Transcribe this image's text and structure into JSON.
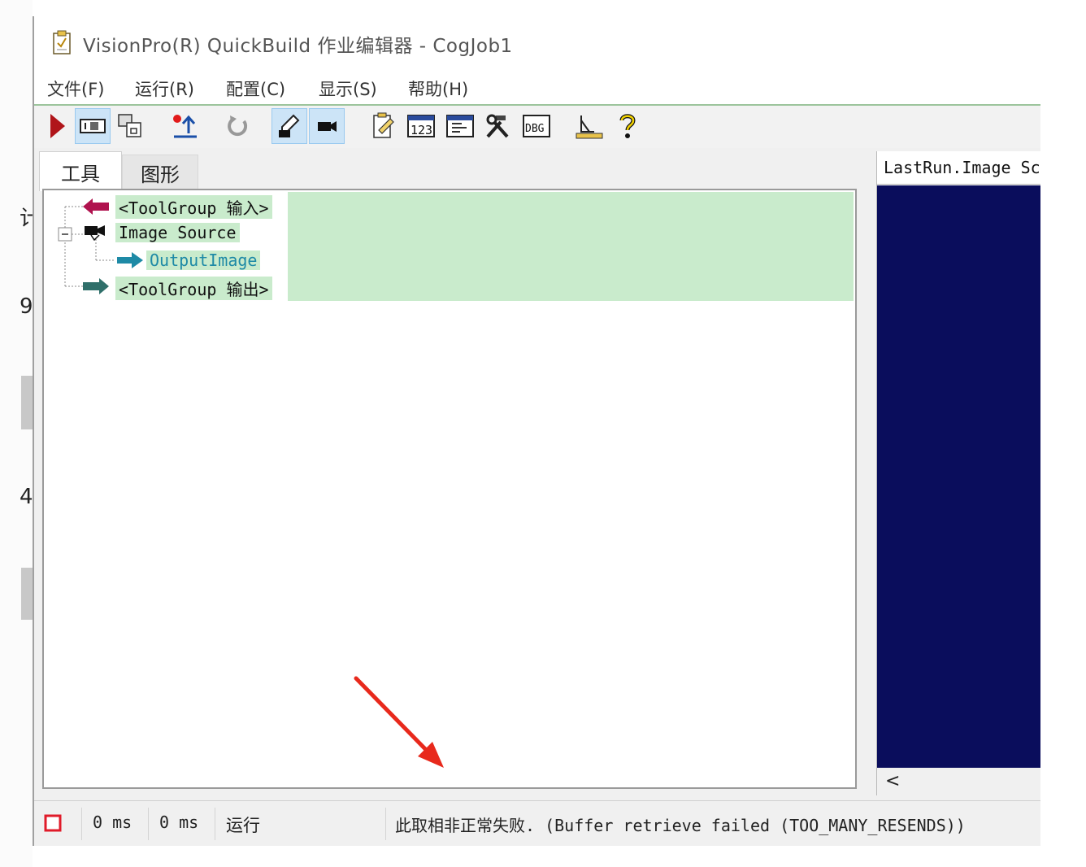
{
  "background_window": {
    "clipped_chars": [
      "计",
      "9.",
      "4."
    ]
  },
  "window": {
    "title": "VisionPro(R) QuickBuild 作业编辑器 - CogJob1"
  },
  "menu": {
    "items": [
      "文件(F)",
      "运行(R)",
      "配置(C)",
      "显示(S)",
      "帮助(H)"
    ]
  },
  "toolbar": {
    "buttons": [
      {
        "icon": "run-icon"
      },
      {
        "icon": "job-view-icon",
        "pressed": true
      },
      {
        "icon": "copy-window-icon"
      },
      {
        "icon": "upload-icon"
      },
      {
        "icon": "reset-icon"
      },
      {
        "icon": "edit-tool-icon",
        "pressed": true
      },
      {
        "icon": "camera-icon",
        "pressed": true
      },
      {
        "icon": "notepad-icon"
      },
      {
        "icon": "counter-123-icon"
      },
      {
        "icon": "display-icon"
      },
      {
        "icon": "hammer-wrench-icon"
      },
      {
        "icon": "dbg-icon"
      },
      {
        "icon": "geometry-ruler-icon"
      },
      {
        "icon": "help-icon"
      }
    ]
  },
  "tabs": {
    "tools": "工具",
    "graphics": "图形"
  },
  "tree": {
    "input": "<ToolGroup 输入>",
    "image_source": "Image Source",
    "output_image": "OutputImage",
    "output": "<ToolGroup 输出>"
  },
  "right_panel": {
    "title": "LastRun.Image Sc",
    "scroll_left": "<"
  },
  "status": {
    "time1": "0 ms",
    "time2": "0 ms",
    "state": "运行",
    "message": "此取相非正常失败. (Buffer retrieve failed (TOO_MANY_RESENDS))"
  },
  "colors": {
    "tree_highlight": "#c9ebcc",
    "image_canvas": "#0a0d5c",
    "annotation_arrow": "#e8291c"
  }
}
